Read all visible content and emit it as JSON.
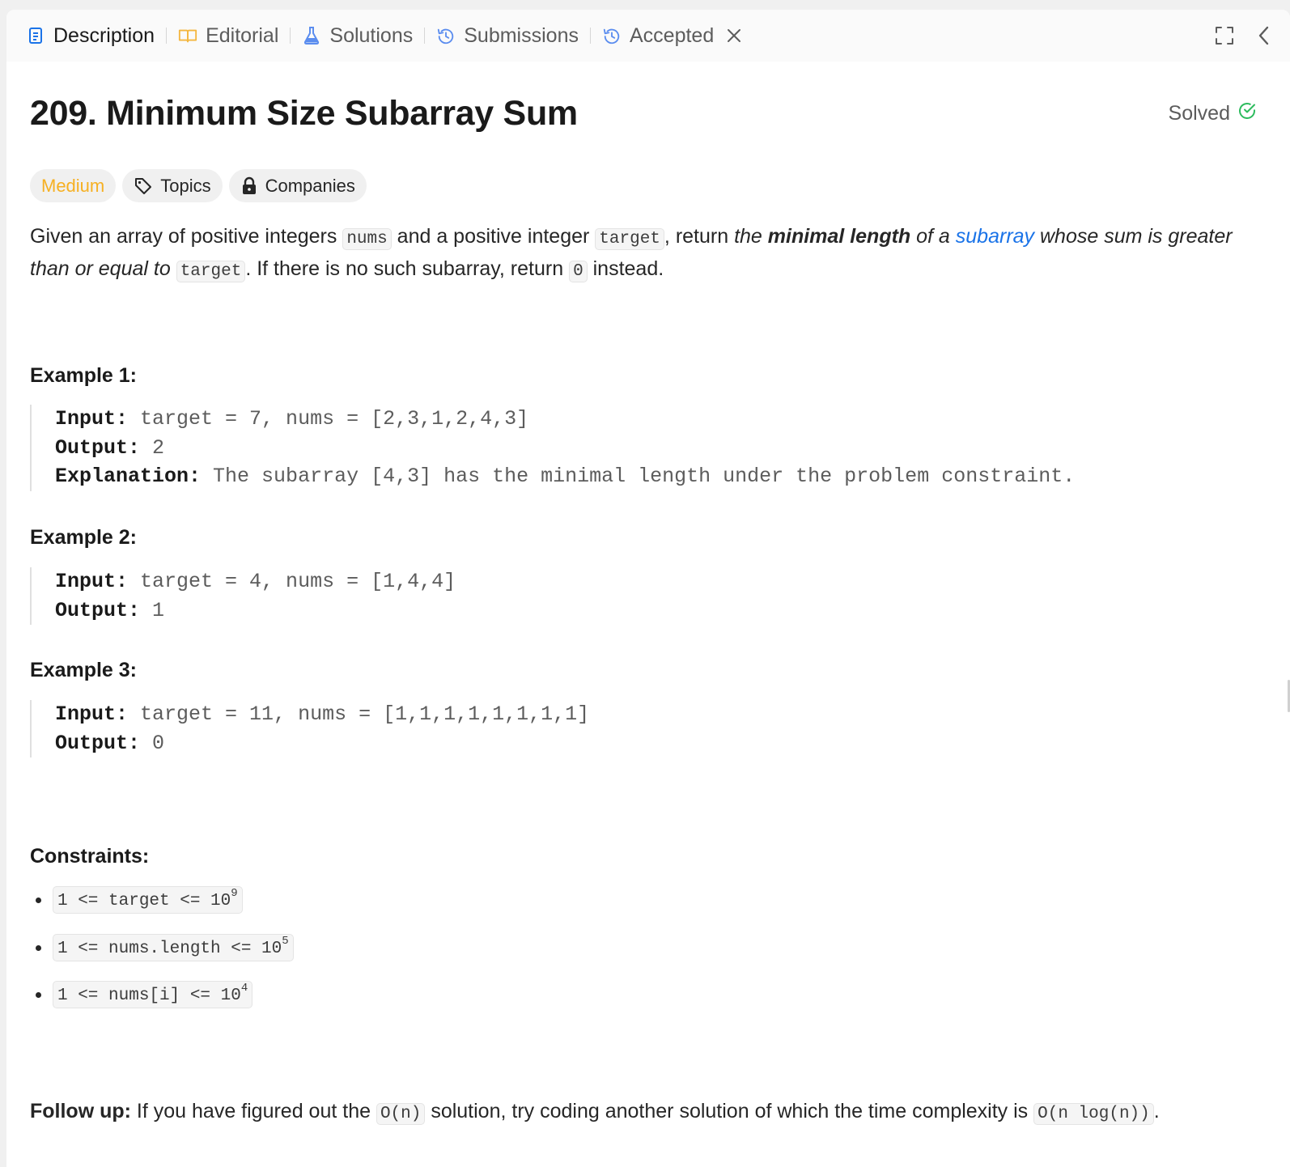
{
  "tabs": [
    {
      "label": "Description",
      "icon": "description-icon"
    },
    {
      "label": "Editorial",
      "icon": "book-icon"
    },
    {
      "label": "Solutions",
      "icon": "flask-icon"
    },
    {
      "label": "Submissions",
      "icon": "history-icon"
    },
    {
      "label": "Accepted",
      "icon": "history-icon"
    }
  ],
  "problem": {
    "title": "209. Minimum Size Subarray Sum",
    "status": "Solved",
    "difficulty": "Medium",
    "topics_label": "Topics",
    "companies_label": "Companies",
    "description": {
      "p1": "Given an array of positive integers ",
      "c_nums": "nums",
      "p2": " and a positive integer ",
      "c_target": "target",
      "p3": ", return ",
      "i1": "the ",
      "b1": "minimal length",
      "i2": " of a ",
      "link": "subarray",
      "i3": " whose sum is greater than or equal to",
      "p4": " ",
      "c_target2": "target",
      "p5": ". If there is no such subarray, return ",
      "c_zero": "0",
      "p6": " instead."
    }
  },
  "examples": [
    {
      "title": "Example 1:",
      "input_label": "Input:",
      "input": "target = 7, nums = [2,3,1,2,4,3]",
      "output_label": "Output:",
      "output": "2",
      "explanation_label": "Explanation:",
      "explanation": "The subarray [4,3] has the minimal length under the problem constraint."
    },
    {
      "title": "Example 2:",
      "input_label": "Input:",
      "input": "target = 4, nums = [1,4,4]",
      "output_label": "Output:",
      "output": "1"
    },
    {
      "title": "Example 3:",
      "input_label": "Input:",
      "input": "target = 11, nums = [1,1,1,1,1,1,1,1]",
      "output_label": "Output:",
      "output": "0"
    }
  ],
  "constraints": {
    "title": "Constraints:",
    "items": [
      {
        "code": "1 <= target <= 10",
        "sup": "9"
      },
      {
        "code": "1 <= nums.length <= 10",
        "sup": "5"
      },
      {
        "code": "1 <= nums[i] <= 10",
        "sup": "4"
      }
    ]
  },
  "followup": {
    "label": "Follow up:",
    "t1": " If you have figured out the ",
    "c1": "O(n)",
    "t2": " solution, try coding another solution of which the time complexity is ",
    "c2": "O(n log(n))",
    "t3": "."
  },
  "colors": {
    "accent_blue": "#1a73e8",
    "medium": "#f6b022",
    "solved_green": "#2cbb5d",
    "tab_icon_editorial": "#f4b740",
    "tab_icon_blue": "#5b8def"
  }
}
